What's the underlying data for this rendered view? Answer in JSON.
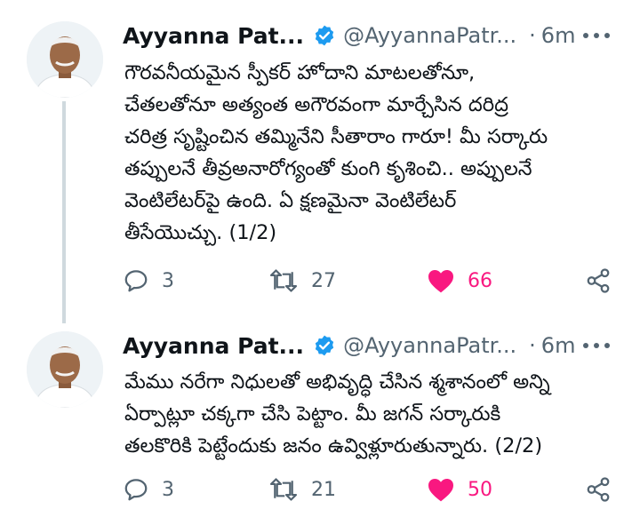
{
  "tweets": [
    {
      "author_name": "Ayyanna Pat...",
      "handle": "@AyyannaPatr...",
      "dot": "·",
      "time": "6m",
      "text": "గౌరవనీయమైన స్పీకర్ హోదాని  మాటలతోనూ,\nచేతలతోనూ అత్యంత అగౌరవంగా మార్చేసిన దరిద్ర\nచరిత్ర సృష్టించిన తమ్మినేని సీతారాం గారూ! మీ సర్కారు\nతప్పులనే తీవ్రఅనారోగ్యంతో కుంగి కృశించి.. అప్పులనే\nవెంటిలేటర్‌పై ఉంది. ఏ క్షణమైనా వెంటిలేటర్\nతీసేయొచ్చు. (1/2)",
      "replies": "3",
      "retweets": "27",
      "likes": "66"
    },
    {
      "author_name": "Ayyanna Pat...",
      "handle": "@AyyannaPatr...",
      "dot": "·",
      "time": "6m",
      "text": "మేము నరేగా నిధులతో అభివృద్ధి చేసిన శ్మశానంలో అన్ని\nఏర్పాట్లూ చక్కగా చేసి పెట్టాం. మీ జగన్ సర్కారుకి\nతలకొరికి పెట్టేందుకు జనం ఉవ్విళ్లూరుతున్నారు. (2/2)",
      "replies": "3",
      "retweets": "21",
      "likes": "50"
    }
  ],
  "colors": {
    "like_pink": "#f91880",
    "verified_blue": "#1d9bf0",
    "muted": "#536471",
    "text": "#0f1419"
  },
  "icons": [
    "verified-badge-icon",
    "more-icon",
    "reply-icon",
    "retweet-icon",
    "like-icon",
    "share-icon"
  ]
}
